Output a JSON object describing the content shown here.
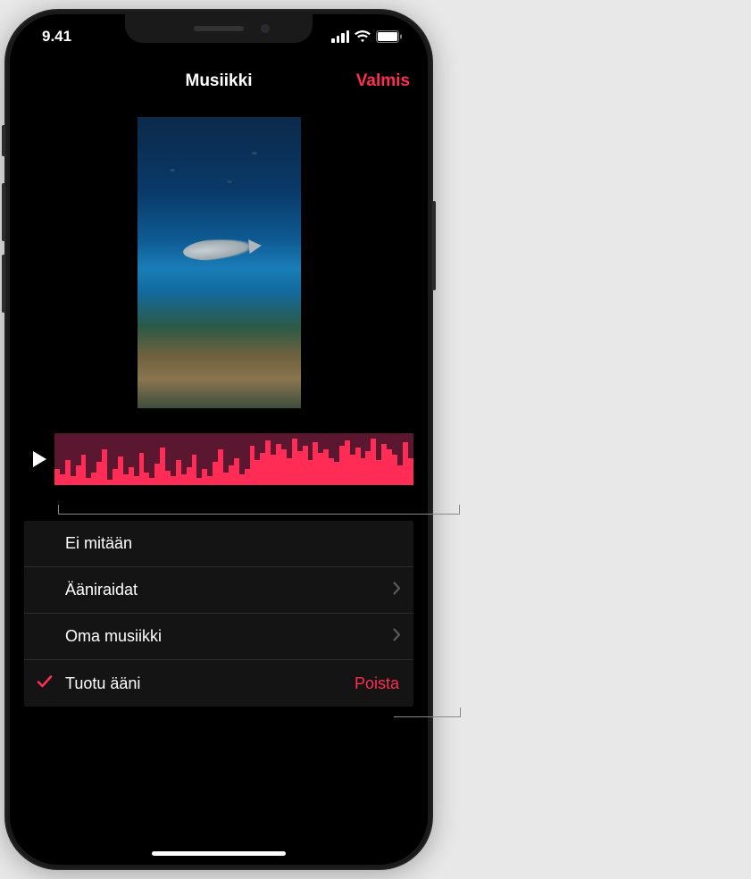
{
  "status_bar": {
    "time": "9.41"
  },
  "nav": {
    "title": "Musiikki",
    "done": "Valmis"
  },
  "options": {
    "none": "Ei mitään",
    "soundtracks": "Ääniraidat",
    "my_music": "Oma musiikki",
    "imported_audio": "Tuotu ääni",
    "delete": "Poista"
  },
  "waveform": {
    "heights": [
      18,
      12,
      28,
      10,
      22,
      34,
      8,
      14,
      26,
      40,
      6,
      18,
      32,
      12,
      20,
      10,
      36,
      14,
      8,
      24,
      42,
      16,
      10,
      28,
      12,
      20,
      34,
      8,
      18,
      10,
      26,
      40,
      14,
      22,
      30,
      12,
      18,
      44,
      28,
      36,
      50,
      34,
      46,
      40,
      30,
      52,
      38,
      44,
      28,
      48,
      36,
      40,
      30,
      26,
      44,
      50,
      34,
      42,
      30,
      38,
      52,
      28,
      46,
      40,
      34,
      22,
      48,
      30
    ]
  },
  "colors": {
    "accent": "#ff2d55"
  }
}
